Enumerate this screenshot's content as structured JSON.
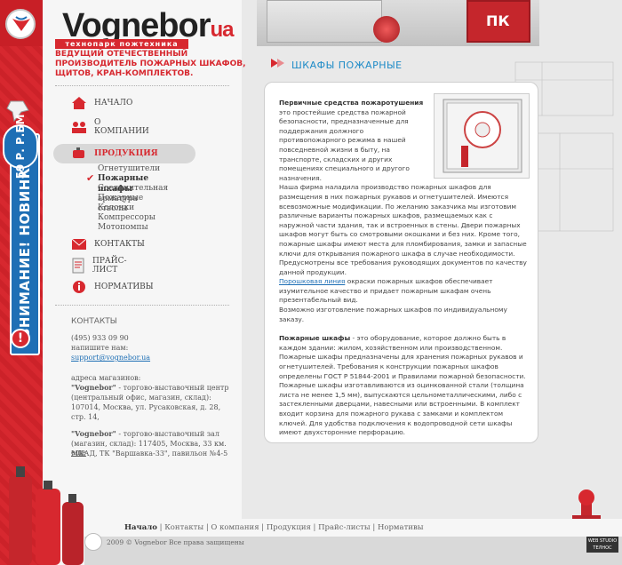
{
  "brand": {
    "name": "Vognebor",
    "ua": "ua",
    "subtitle": "технопарк пожтехника",
    "tagline": "ВЕДУЩИЙ ОТЕЧЕСТВЕННЫЙ ПРОИЗВОДИТЕЛЬ ПОЖАРНЫХ ШКАФОВ, ЩИТОВ, КРАН-КОМПЛЕКТОВ."
  },
  "header": {
    "cabinet_label": "ПК"
  },
  "sidebar_promo": {
    "price": "59 Р. Р.БМ",
    "banner": "ВНИМАНИЕ! НОВИНКА!",
    "alert": "!"
  },
  "nav": {
    "items": [
      {
        "label": "НАЧАЛО",
        "icon": "home-icon"
      },
      {
        "label": "О КОМПАНИИ",
        "icon": "people-icon"
      },
      {
        "label": "ПРОДУКЦИЯ",
        "icon": "fire-extinguisher-icon"
      },
      {
        "label": "КОНТАКТЫ",
        "icon": "mail-icon"
      },
      {
        "label": "ПРАЙС-ЛИСТ",
        "icon": "price-list-icon"
      },
      {
        "label": "НОРМАТИВЫ",
        "icon": "info-icon"
      }
    ],
    "products": [
      "Огнетушители",
      "Пожарные шкафы",
      "Соединительная арматура",
      "Пожарные стволы",
      "Колонки",
      "Компрессоры",
      "Мотопомпы"
    ]
  },
  "contacts": {
    "heading": "КОНТАКТЫ",
    "phone": "(495) 933 09 90",
    "write_label": "напишите нам:",
    "email": "support@vognebor.ua",
    "addresses_label": "адреса магазинов:",
    "store1_name": "\"Vognebor\"",
    "store1_text": " - торгово-выставочный центр (центральный офис, магазин, склад): 107014, Москва, ул. Русаковская, д. 28, стр. 14,",
    "store2_name": "\"Vognebor\"",
    "store2_text": " - торгово-выставочный зал (магазин, склад): 117405, Москва, 33 км. МКАД, ТК \"Варшавка-33\", павильон №4-5",
    "more": "еще"
  },
  "page": {
    "title": "ШКАФЫ ПОЖАРНЫЕ"
  },
  "content": {
    "h1": "Первичные средства пожаротушения",
    "p1": " это простейшие средства пожарной безопасности, предназначенные для поддержания должного противопожарного режима в нашей повседневной жизни в быту, на транспорте, складских и других помещениях специального и другого назначения.",
    "p2": "Наша фирма наладила производство пожарных шкафов для размещения в них пожарных рукавов и огнетушителей. Имеются всевозможные модификации. По желанию заказчика мы изготовим различные варианты пожарных шкафов, размещаемых как с наружной части здания, так и встроенных в стены. Двери пожарных шкафов могут быть со смотровыми окошками и без них. Кроме того, пожарные шкафы имеют места для пломбирования, замки и запасные ключи для открывания пожарного шкафа в случае необходимости. Предусмотрены все требования руководящих документов по качеству данной продукции.",
    "link": "Порошковая линия",
    "p3": " окраски пожарных шкафов обеспечивает изумительное качество и придает пожарным шкафам очень презентабельный вид.",
    "p4": "Возможно изготовление пожарных шкафов по индивидуальному заказу.",
    "h2": "Пожарные шкафы",
    "p5": " - это оборудование, которое должно быть в каждом здании: жилом, хозяйственном или производственном. Пожарные шкафы предназначены для хранения пожарных рукавов и огнетушителей. Требования к конструкции пожарных шкафов определены ГОСТ Р 51844-2001 и Правилами пожарной безопасности. Пожарные шкафы изготавливаются из оцинкованной стали (толщина листа не менее 1,5 мм), выпускаются цельнометаллическими, либо с застекленными дверцами, навесными или встроенными. В комплект входит корзина для пожарного рукава с замками и комплектом ключей. Для удобства подключения к водопроводной сети шкафы имеют двухсторонние перфорацию."
  },
  "footer": {
    "nav": [
      "Начало",
      "Контакты",
      "О компания",
      "Продукция",
      "Прайс-листы",
      "Нормативы"
    ],
    "copyright": "2009 © Vognebor Все права защищены",
    "studio": "WEB STUDIO ТЕЛНОС"
  },
  "colors": {
    "accent_red": "#d7282f",
    "link_blue": "#1e8bc7",
    "panel_bg": "#ffffff"
  }
}
